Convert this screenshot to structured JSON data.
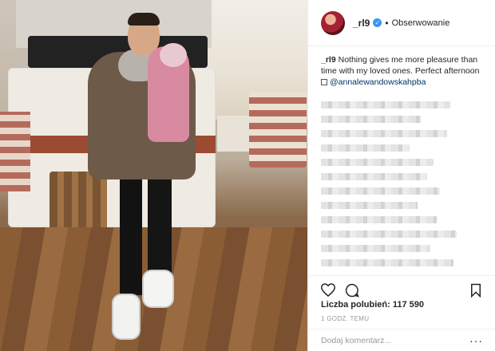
{
  "post": {
    "photo_alt": "Photo"
  },
  "header": {
    "username": "_rl9",
    "verified_glyph": "✓",
    "separator": "•",
    "follow_label": "Obserwowanie"
  },
  "caption": {
    "username": "_rl9",
    "text": "Nothing gives me more pleasure than time with my loved ones. Perfect afternoon",
    "mention": "@annalewandowskahpba"
  },
  "comments": {
    "blurred_widths_pct": [
      80,
      62,
      78,
      55,
      70,
      66,
      74,
      60,
      72,
      84,
      68,
      82
    ]
  },
  "actions": {
    "like_icon": "heart-icon",
    "comment_icon": "comment-icon",
    "save_icon": "bookmark-icon"
  },
  "likes_text": "Liczba polubień: 117 590",
  "time_ago": "1 GODZ. TEMU",
  "comment_placeholder": "Dodaj komentarz...",
  "more_label": "···"
}
